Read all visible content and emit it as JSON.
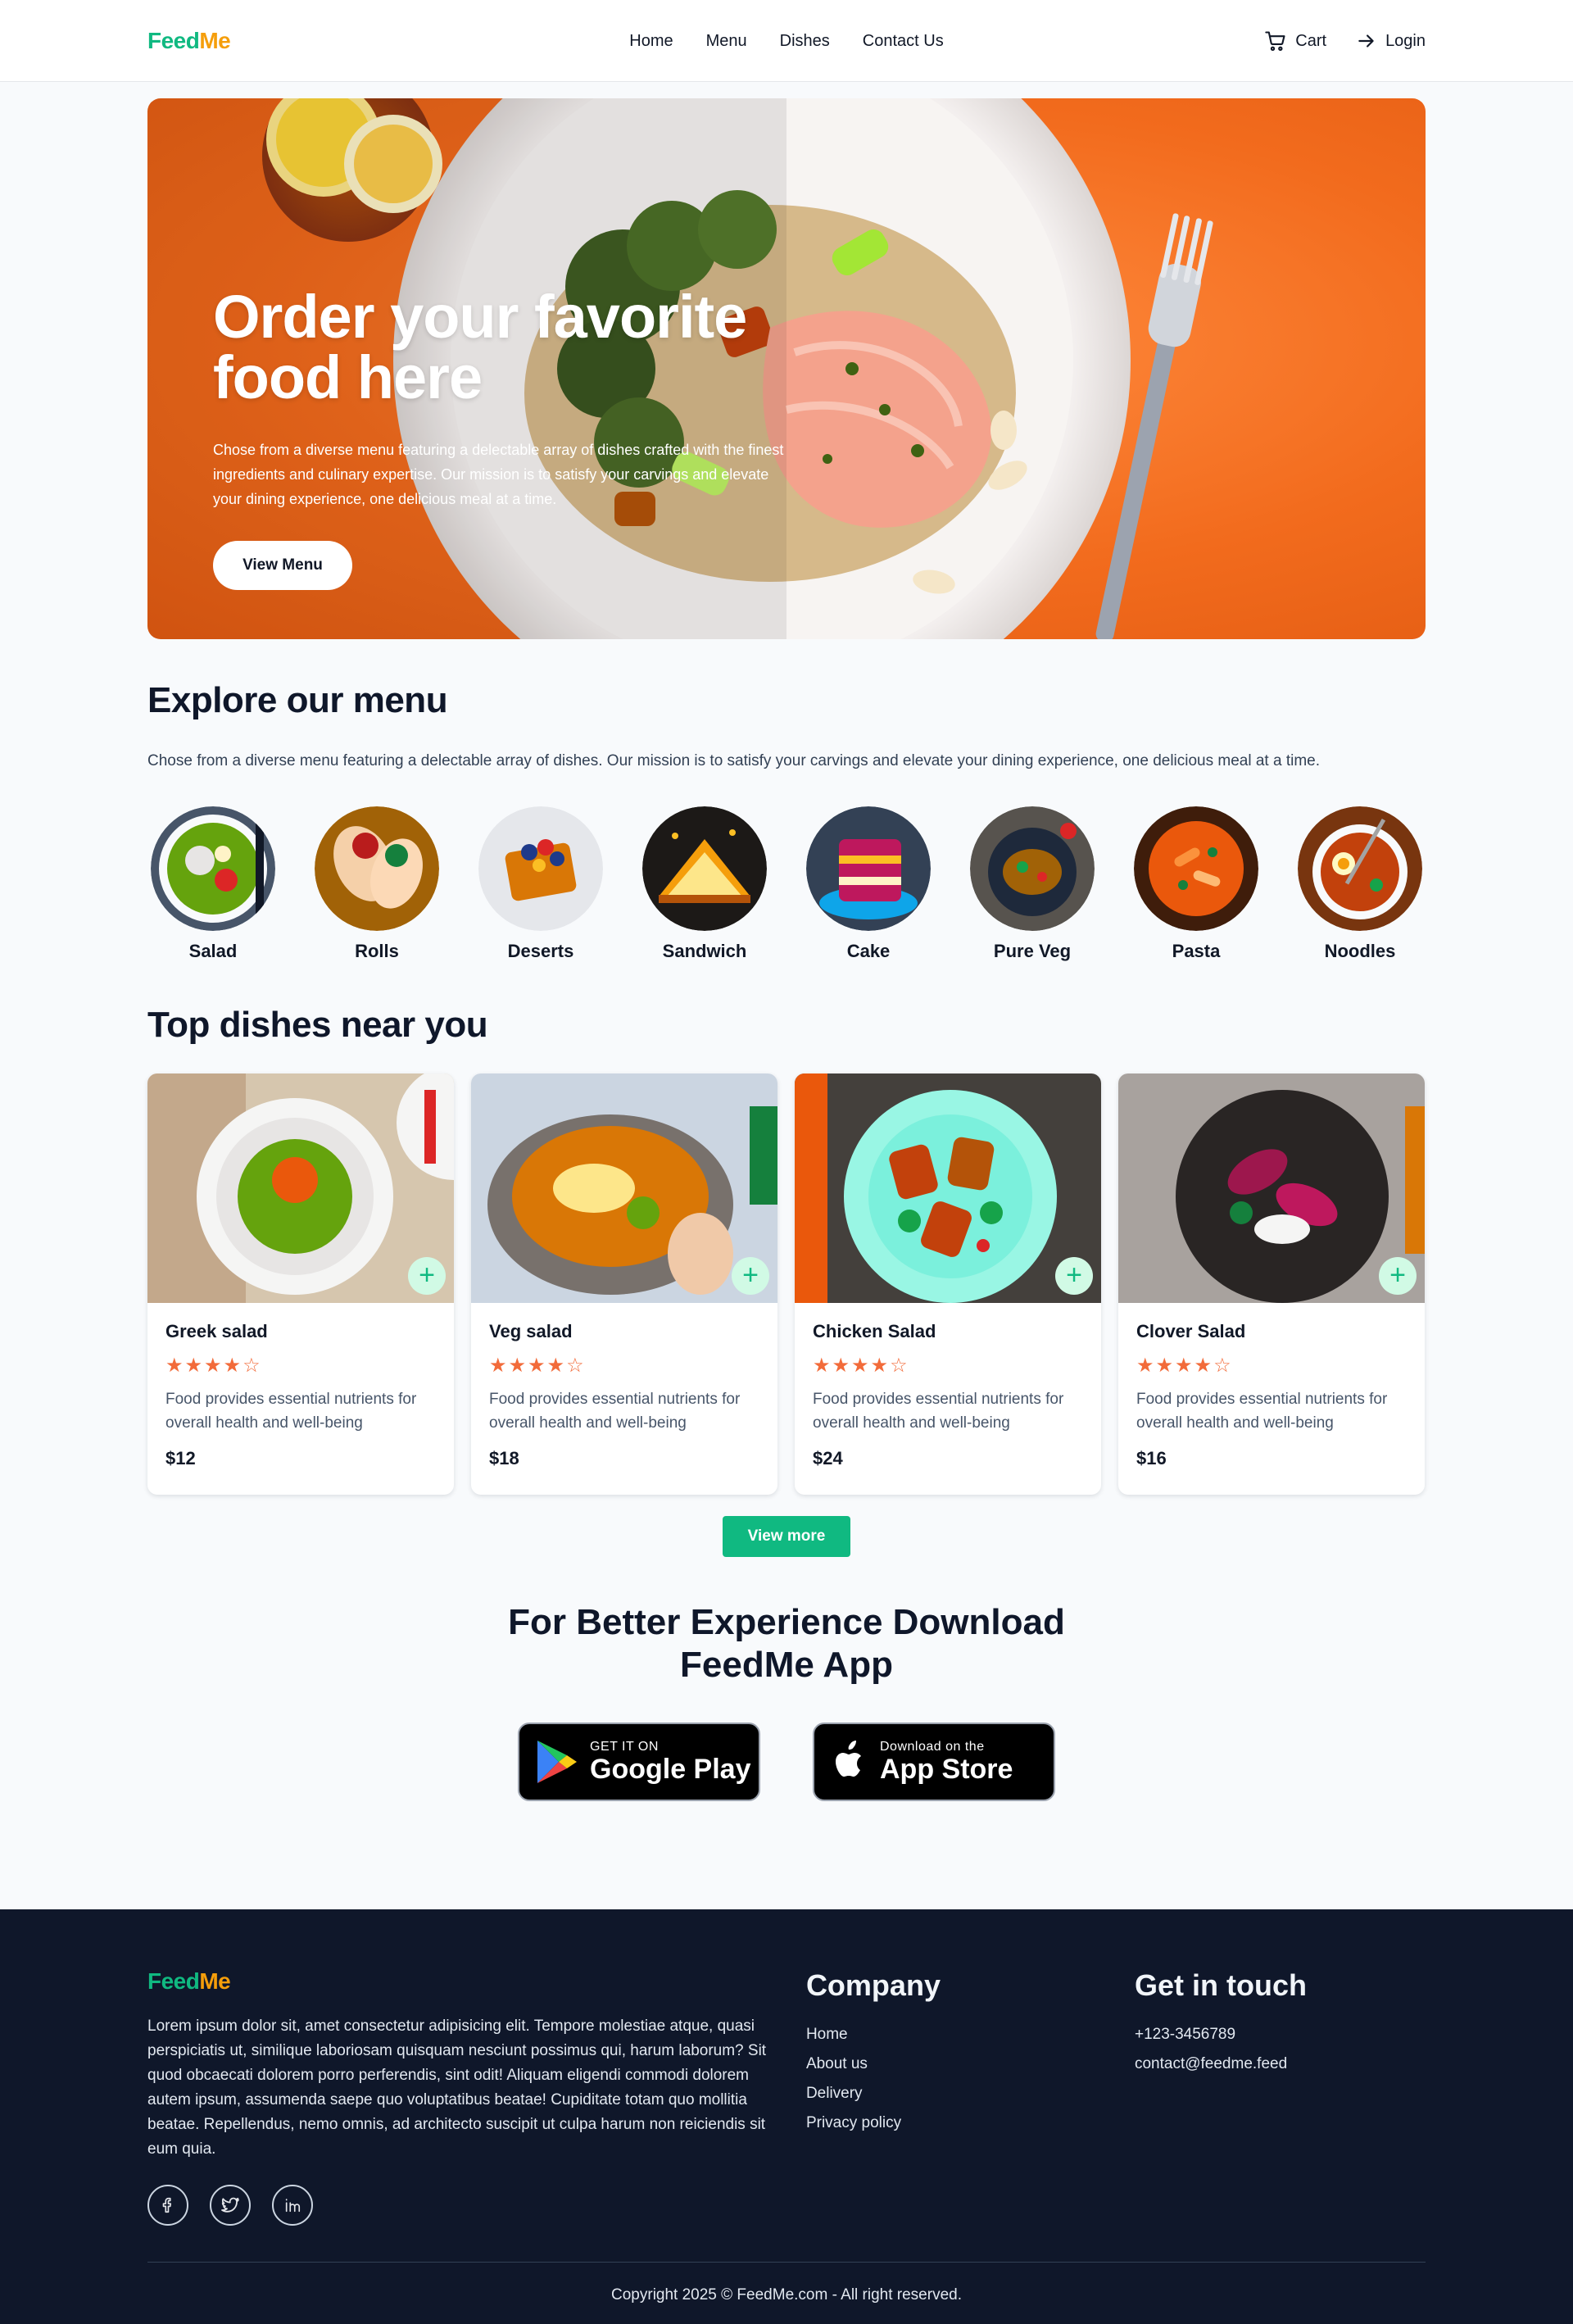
{
  "brand": {
    "part1": "Feed",
    "part2": "Me"
  },
  "nav": {
    "links": [
      "Home",
      "Menu",
      "Dishes",
      "Contact Us"
    ],
    "cart_label": "Cart",
    "login_label": "Login"
  },
  "hero": {
    "title_line1": "Order your favorite",
    "title_line2": "food here",
    "description": "Chose from a diverse menu featuring a delectable array of dishes crafted with the finest ingredients and culinary expertise. Our mission is to satisfy your carvings and elevate your dining experience, one delicious meal at a time.",
    "button_label": "View Menu"
  },
  "explore": {
    "title": "Explore our menu",
    "description": "Chose from a diverse menu featuring a delectable array of dishes. Our mission is to satisfy your carvings and elevate your dining experience, one delicious meal at a time.",
    "categories": [
      "Salad",
      "Rolls",
      "Deserts",
      "Sandwich",
      "Cake",
      "Pure Veg",
      "Pasta",
      "Noodles"
    ]
  },
  "dishes": {
    "title": "Top dishes near you",
    "items": [
      {
        "name": "Greek salad",
        "rating": 4,
        "description": "Food provides essential nutrients for overall health and well-being",
        "price": "$12"
      },
      {
        "name": "Veg salad",
        "rating": 4,
        "description": "Food provides essential nutrients for overall health and well-being",
        "price": "$18"
      },
      {
        "name": "Chicken Salad",
        "rating": 4,
        "description": "Food provides essential nutrients for overall health and well-being",
        "price": "$24"
      },
      {
        "name": "Clover Salad",
        "rating": 4,
        "description": "Food provides essential nutrients for overall health and well-being",
        "price": "$16"
      }
    ],
    "view_more_label": "View more",
    "add_symbol": "+"
  },
  "app": {
    "title_line1": "For Better Experience Download",
    "title_line2": "FeedMe App",
    "google_small": "GET IT ON",
    "google_big": "Google Play",
    "apple_small": "Download on the",
    "apple_big": "App Store"
  },
  "footer": {
    "about": "Lorem ipsum dolor sit, amet consectetur adipisicing elit. Tempore molestiae atque, quasi perspiciatis ut, similique laboriosam quisquam nesciunt possimus qui, harum laborum? Sit quod obcaecati dolorem porro perferendis, sint odit! Aliquam eligendi commodi dolorem autem ipsum, assumenda saepe quo voluptatibus beatae! Cupiditate totam quo mollitia beatae. Repellendus, nemo omnis, ad architecto suscipit ut culpa harum non reiciendis sit eum quia.",
    "company_heading": "Company",
    "company_links": [
      "Home",
      "About us",
      "Delivery",
      "Privacy policy"
    ],
    "contact_heading": "Get in touch",
    "phone": "+123-3456789",
    "email": "contact@feedme.feed",
    "copyright": "Copyright 2025 © FeedMe.com - All right reserved."
  },
  "colors": {
    "brand_green": "#10b981",
    "brand_orange": "#f59e0b",
    "hero_orange": "#f26b1d",
    "star": "#f26b3a",
    "footer_bg": "#0f172a"
  }
}
